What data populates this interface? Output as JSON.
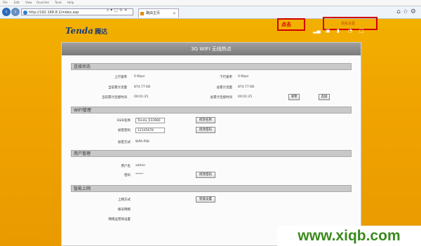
{
  "browser": {
    "menu": [
      "File",
      "Edit",
      "View",
      "Favorites",
      "Tools",
      "Help"
    ],
    "url": "http://192.168.8.1/index.asp",
    "tab_title": "路由主页"
  },
  "header": {
    "logo": "Tenda",
    "logo_cn": "腾达",
    "annotation_click": "点击",
    "advanced_link": "高级设置"
  },
  "panel": {
    "title": "3G WIFI 无线热点",
    "connection": {
      "header": "连接状态",
      "up_rate_label": "上行速率",
      "up_rate": "0 Kbps",
      "down_rate_label": "下行速率",
      "down_rate": "0 Kbps",
      "cur_traffic_label": "当前累计流量",
      "cur_traffic": "874.77 KB",
      "total_traffic_label": "总累计流量",
      "total_traffic": "874.77 KB",
      "cur_time_label": "当前累计连接时间",
      "cur_time": "00:01:25",
      "total_time_label": "总累计连接时间",
      "total_time": "00:01:25",
      "clear_btn": "清零",
      "connect_btn": "连接"
    },
    "wifi": {
      "header": "WIFI管理",
      "ssid_label": "SSID名称",
      "ssid": "Tenda_033980",
      "ssid_btn": "修改名称",
      "pwd_label": "加密密码",
      "pwd": "12345678",
      "pwd_btn": "修改密码",
      "enc_label": "加密方式",
      "enc": "WPA-PSK"
    },
    "user": {
      "header": "用户管理",
      "user_label": "用户名",
      "user": "admin",
      "pass_label": "密码",
      "pass": "*****",
      "pass_btn": "修改密码"
    },
    "mode": {
      "header": "智能上网",
      "method_label": "上网方式",
      "setup_btn": "智能设置",
      "dialup_label": "拨号网络",
      "wan_label": "网络运营商设置"
    }
  },
  "watermark": "www.xiqb.com"
}
